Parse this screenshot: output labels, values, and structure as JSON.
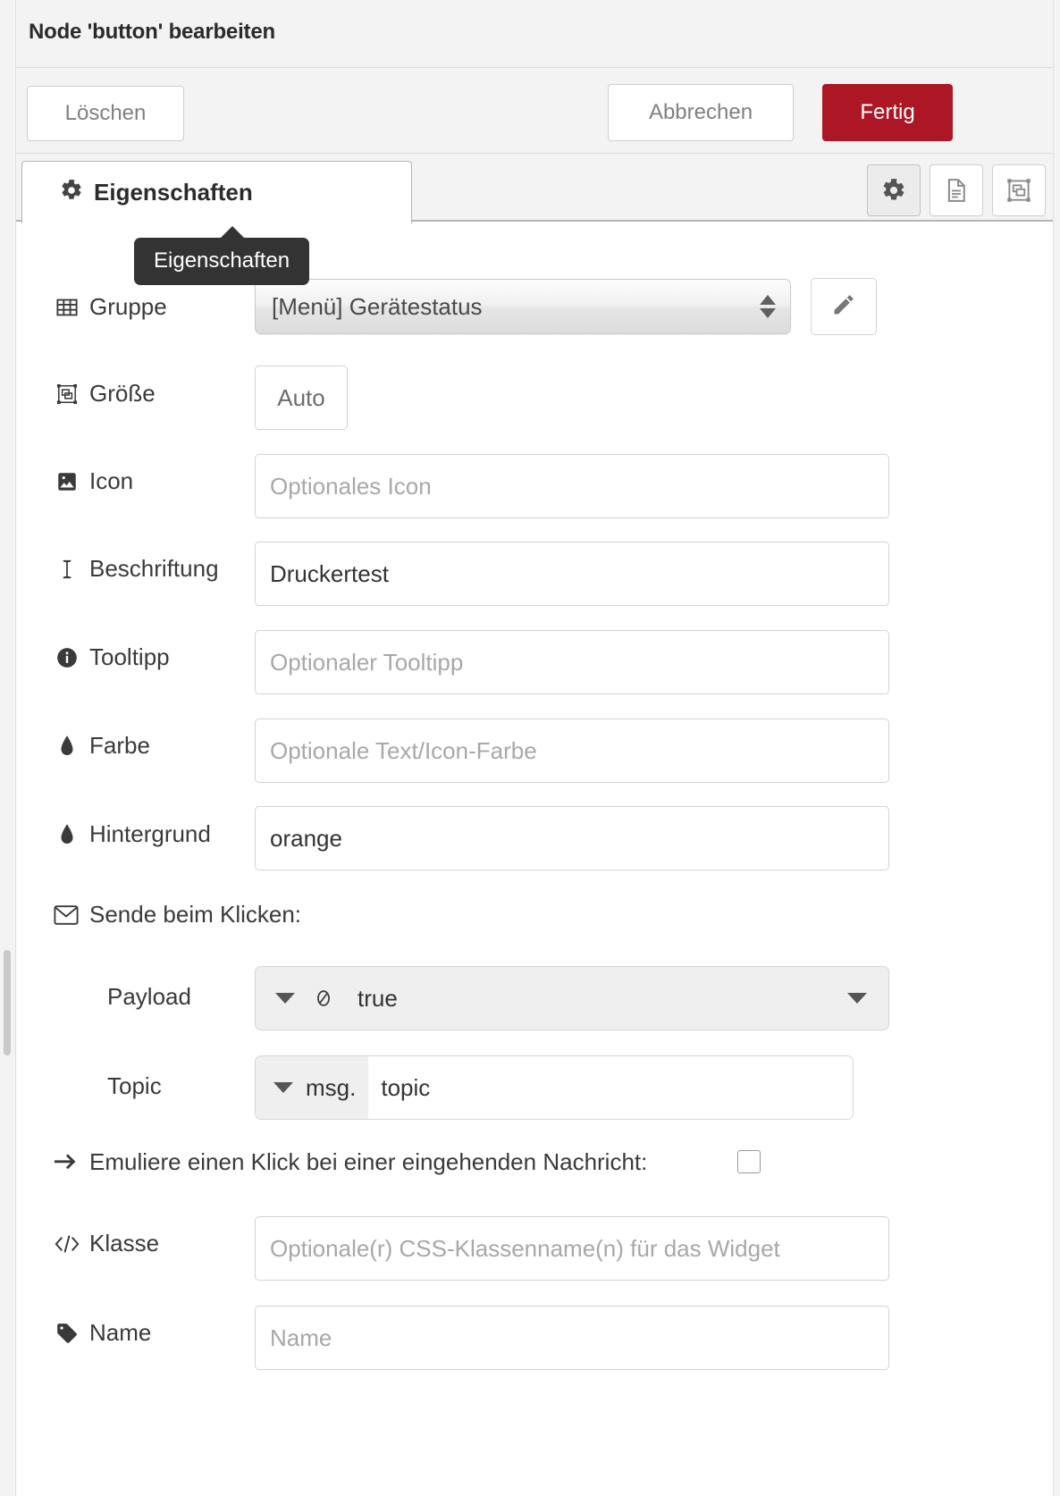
{
  "dialog": {
    "title": "Node 'button' bearbeiten",
    "buttons": {
      "delete": "Löschen",
      "cancel": "Abbrechen",
      "done": "Fertig"
    },
    "done_color": "#ad1625"
  },
  "tabs": {
    "active": "Eigenschaften",
    "icon_buttons": [
      {
        "name": "gear-icon",
        "active": true
      },
      {
        "name": "description-icon",
        "active": false
      },
      {
        "name": "appearance-icon",
        "active": false
      }
    ]
  },
  "tooltip": {
    "text": "Eigenschaften"
  },
  "form": {
    "group": {
      "label": "Gruppe",
      "icon": "table-icon",
      "value": "[Menü] Gerätestatus",
      "edit_button": "pencil-icon"
    },
    "size": {
      "label": "Größe",
      "icon": "resize-icon",
      "value": "Auto"
    },
    "icon_field": {
      "label": "Icon",
      "icon": "image-icon",
      "placeholder": "Optionales Icon",
      "value": ""
    },
    "caption": {
      "label": "Beschriftung",
      "icon": "text-cursor-icon",
      "placeholder": "",
      "value": "Druckertest"
    },
    "tooltip_field": {
      "label": "Tooltipp",
      "icon": "info-icon",
      "placeholder": "Optionaler Tooltipp",
      "value": ""
    },
    "color": {
      "label": "Farbe",
      "icon": "tint-icon",
      "placeholder": "Optionale Text/Icon-Farbe",
      "value": ""
    },
    "background": {
      "label": "Hintergrund",
      "icon": "tint-icon",
      "placeholder": "",
      "value": "orange"
    },
    "send_on_click": {
      "label": "Sende beim Klicken:",
      "icon": "envelope-icon"
    },
    "payload": {
      "label": "Payload",
      "type": "bool",
      "type_icon": "boolean-icon",
      "value": "true"
    },
    "topic": {
      "label": "Topic",
      "prefix": "msg.",
      "value": "topic"
    },
    "emulate_click": {
      "label": "Emuliere einen Klick bei einer eingehenden Nachricht:",
      "icon": "arrow-right-icon",
      "checked": false
    },
    "css_class": {
      "label": "Klasse",
      "icon": "code-icon",
      "placeholder": "Optionale(r) CSS-Klassenname(n) für das Widget",
      "value": ""
    },
    "name": {
      "label": "Name",
      "icon": "tag-icon",
      "placeholder": "Name",
      "value": ""
    }
  }
}
